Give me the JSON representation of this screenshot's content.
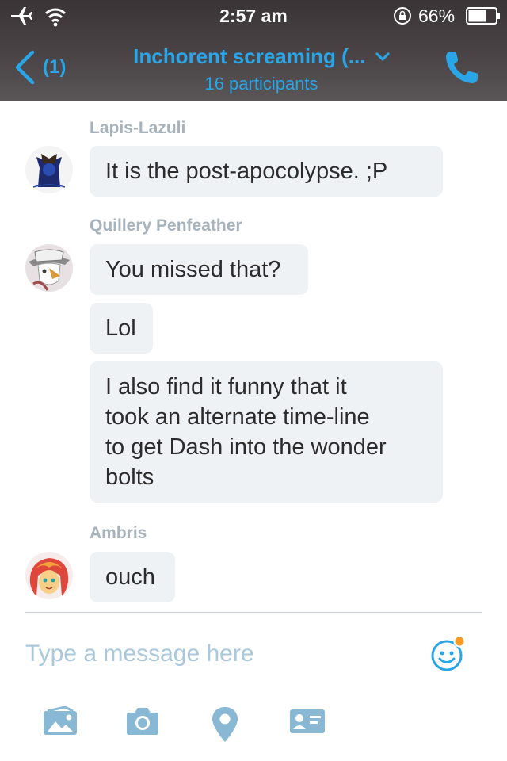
{
  "status_bar": {
    "time": "2:57 am",
    "battery_percent": "66%",
    "battery_level": 0.66,
    "icons": [
      "airplane-icon",
      "wifi-icon",
      "rotation-lock-icon",
      "battery-icon"
    ]
  },
  "header": {
    "back_count": "(1)",
    "title": "Inchorent screaming (...",
    "subtitle": "16 participants",
    "accent_color": "#2aa6e8"
  },
  "messages": [
    {
      "sender": "Lapis-Lazuli",
      "texts": [
        "It is the post-apocolypse. ;P"
      ]
    },
    {
      "sender": "Quillery Penfeather",
      "texts": [
        "You missed that?",
        "Lol",
        "I also find it funny that it\ntook an alternate time-line\nto get Dash into the wonder\nbolts"
      ]
    },
    {
      "sender": "Ambris",
      "texts": [
        "ouch"
      ]
    }
  ],
  "composer": {
    "placeholder": "Type a message here",
    "icon": "emoji-icon"
  },
  "toolbar": {
    "icons": [
      "media-icon",
      "camera-icon",
      "location-icon",
      "contact-card-icon"
    ]
  }
}
